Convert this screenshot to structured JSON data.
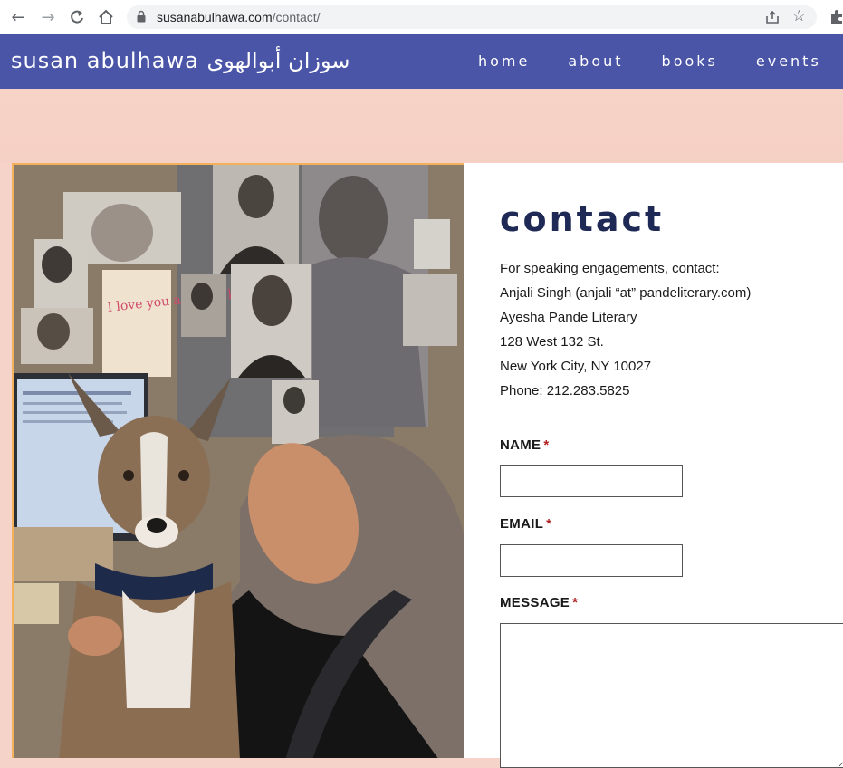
{
  "browser": {
    "url_domain": "susanabulhawa.com",
    "url_path": "/contact/"
  },
  "site": {
    "title": "susan abulhawa سوزان أبوالهوى",
    "nav": [
      "home",
      "about",
      "books",
      "events"
    ]
  },
  "contact": {
    "heading": "contact",
    "info_lines": [
      "For speaking engagements, contact:",
      "Anjali Singh (anjali “at” pandeliterary.com)",
      "Ayesha Pande Literary",
      "128 West 132 St.",
      "New York City, NY 10027",
      "Phone: 212.283.5825"
    ],
    "fields": {
      "name_label": "NAME",
      "email_label": "EMAIL",
      "message_label": "MESSAGE",
      "required_mark": "*",
      "name_value": "",
      "email_value": "",
      "message_value": ""
    }
  },
  "photo": {
    "handwritten_note": "I love you and you know that"
  },
  "icons": [
    "back-arrow-icon",
    "forward-arrow-icon",
    "reload-icon",
    "home-icon",
    "lock-icon",
    "share-icon",
    "star-icon",
    "extensions-icon"
  ],
  "colors": {
    "header_bg": "#4a55a8",
    "page_bg": "#f6d3c9",
    "heading": "#1e2a55",
    "required": "#b02020"
  }
}
